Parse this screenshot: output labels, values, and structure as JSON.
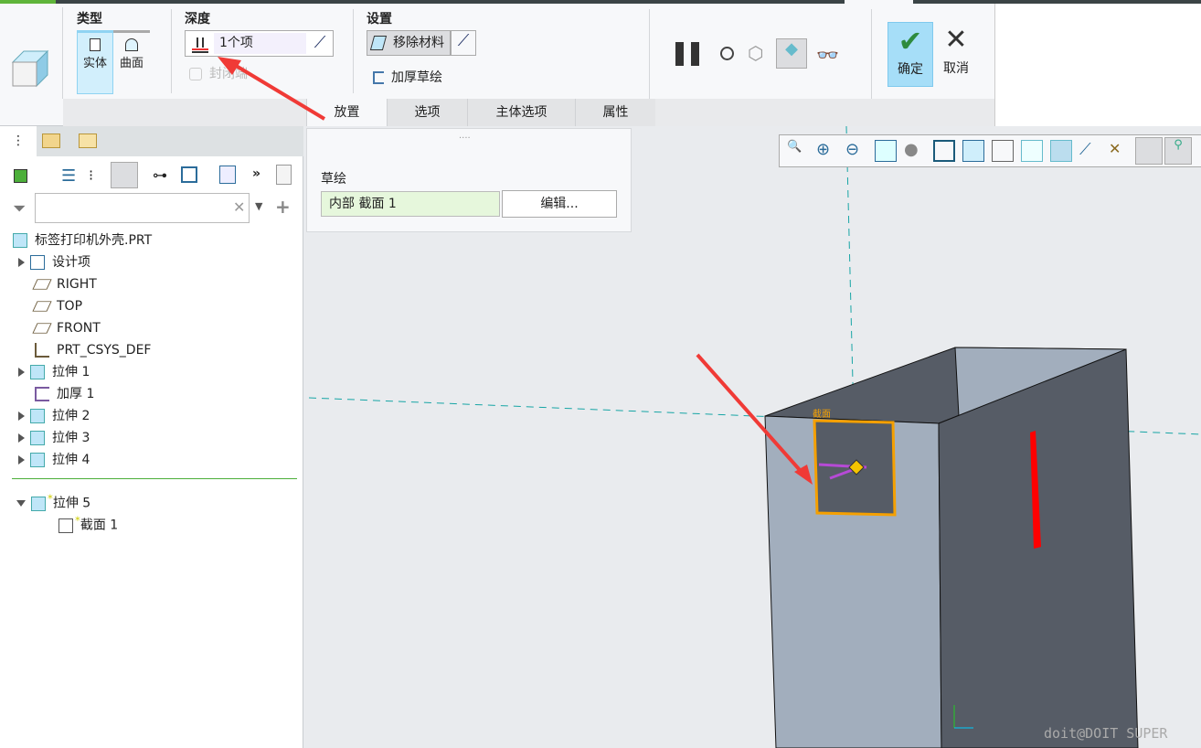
{
  "ribbon": {
    "type_label": "类型",
    "solid": "实体",
    "surface": "曲面",
    "depth_label": "深度",
    "depth_value": "1个项",
    "capped": "封闭端",
    "settings_label": "设置",
    "remove_material": "移除材料",
    "thicken": "加厚草绘",
    "ok": "确定",
    "cancel": "取消",
    "tabs": [
      "放置",
      "选项",
      "主体选项",
      "属性"
    ]
  },
  "placement": {
    "sketch_label": "草绘",
    "sketch_value": "内部 截面 1",
    "edit_button": "编辑..."
  },
  "tree": {
    "search_placeholder": "",
    "items": [
      {
        "label": "标签打印机外壳.PRT"
      },
      {
        "label": "设计项"
      },
      {
        "label": "RIGHT"
      },
      {
        "label": "TOP"
      },
      {
        "label": "FRONT"
      },
      {
        "label": "PRT_CSYS_DEF"
      },
      {
        "label": "拉伸 1"
      },
      {
        "label": "加厚 1"
      },
      {
        "label": "拉伸 2"
      },
      {
        "label": "拉伸 3"
      },
      {
        "label": "拉伸 4"
      },
      {
        "label": "拉伸 5"
      },
      {
        "label": "截面 1"
      }
    ]
  },
  "viewport": {
    "section_tag": "截面",
    "watermark": "doit@DOIT SUPER"
  },
  "colors": {
    "accent": "#a6def8",
    "arrow": "#f03a36",
    "section": "#f5a000",
    "cut": "#ff0000"
  }
}
